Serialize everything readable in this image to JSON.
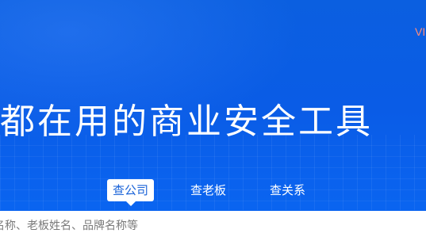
{
  "vip": {
    "label": "VI"
  },
  "headline": "都在用的商业安全工具",
  "tabs": [
    {
      "label": "查公司",
      "active": true
    },
    {
      "label": "查老板",
      "active": false
    },
    {
      "label": "查关系",
      "active": false
    }
  ],
  "search": {
    "placeholder": "名称、老板姓名、品牌名称等"
  },
  "colors": {
    "background": "#0a5ce6",
    "active_tab_text": "#1a63d8",
    "vip_text": "#ff8c7a"
  }
}
